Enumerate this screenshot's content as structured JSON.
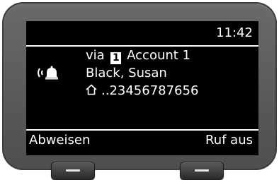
{
  "status": {
    "time": "11:42"
  },
  "call": {
    "via_prefix": "via",
    "account_number": "1",
    "account_name": "Account 1",
    "caller_name": "Black, Susan",
    "caller_number": "..23456787656"
  },
  "icons": {
    "ringing": "ringing-bell-icon",
    "home": "home-icon"
  },
  "softkeys": {
    "left_label": "Abweisen",
    "right_label": "Ruf aus"
  }
}
